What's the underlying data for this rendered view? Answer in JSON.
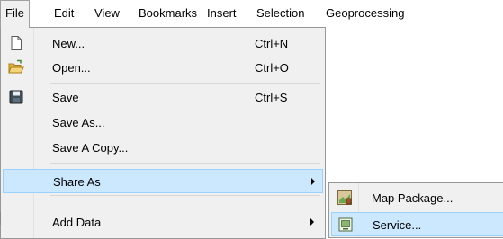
{
  "menubar": {
    "items": [
      {
        "label": "File"
      },
      {
        "label": "Edit"
      },
      {
        "label": "View"
      },
      {
        "label": "Bookmarks"
      },
      {
        "label": "Insert"
      },
      {
        "label": "Selection"
      },
      {
        "label": "Geoprocessing"
      }
    ]
  },
  "file_menu": {
    "items": [
      {
        "label": "New...",
        "shortcut": "Ctrl+N",
        "icon": "new-document-icon"
      },
      {
        "label": "Open...",
        "shortcut": "Ctrl+O",
        "icon": "open-folder-icon"
      },
      {
        "label": "Save",
        "shortcut": "Ctrl+S",
        "icon": "save-disk-icon"
      },
      {
        "label": "Save As..."
      },
      {
        "label": "Save A Copy..."
      },
      {
        "label": "Share As",
        "submenu": true,
        "highlighted": true
      },
      {
        "label": "Add Data",
        "submenu": true
      }
    ]
  },
  "share_as_submenu": {
    "items": [
      {
        "label": "Map Package...",
        "icon": "map-package-icon"
      },
      {
        "label": "Service...",
        "icon": "service-icon",
        "highlighted": true
      }
    ]
  },
  "colors": {
    "menu_background": "#f0f0f0",
    "highlight_fill": "#cce8ff",
    "highlight_border": "#99d1ff"
  }
}
